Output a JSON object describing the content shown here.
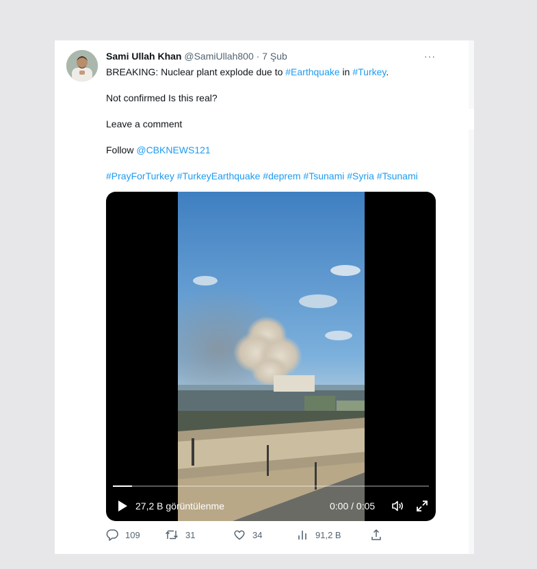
{
  "tweet": {
    "author_name": "Sami Ullah Khan",
    "author_handle": "@SamiUllah800",
    "separator": "·",
    "date": "7 Şub",
    "more": "···",
    "text_line1_prefix": "BREAKING: Nuclear plant explode due to ",
    "hashtag_earthquake": "#Earthquake",
    "text_line1_middle": " in ",
    "hashtag_turkey": "#Turkey",
    "text_line1_suffix": ".",
    "text_line2": "Not confirmed Is this real?",
    "text_line3": "Leave a comment",
    "text_line4_prefix": "Follow ",
    "mention": "@CBKNEWS121",
    "hashtags_line": "#PrayForTurkey #TurkeyEarthquake #deprem #Tsunami #Syria #Tsunami"
  },
  "video": {
    "views": "27,2 B görüntülenme",
    "time": "0:00 / 0:05",
    "progress_fraction": 0.06
  },
  "actions": {
    "replies": "109",
    "retweets": "31",
    "likes": "34",
    "views": "91,2 B"
  },
  "colors": {
    "link": "#1d9bf0",
    "text": "#0f1419",
    "secondary": "#536471",
    "background": "#e7e7e9"
  },
  "icons": [
    "more-icon",
    "play-icon",
    "volume-icon",
    "fullscreen-icon",
    "reply-icon",
    "retweet-icon",
    "like-icon",
    "views-icon",
    "share-icon"
  ]
}
